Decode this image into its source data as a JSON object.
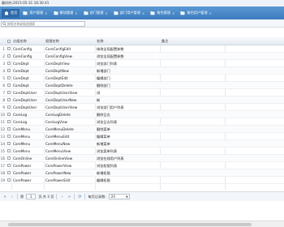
{
  "topbar": {
    "text": "最好的:2015-05-31 18:30:41"
  },
  "tabs": [
    {
      "label": "首页",
      "icon": "home-icon"
    },
    {
      "label": "用户管理",
      "icon": "folder-icon"
    },
    {
      "label": "模块管理",
      "icon": "folder-icon"
    },
    {
      "label": "部门管理",
      "icon": "folder-icon"
    },
    {
      "label": "部门用户管理",
      "icon": "folder-icon"
    },
    {
      "label": "角色管理",
      "icon": "folder-icon"
    },
    {
      "label": "角色用户管理",
      "icon": "folder-icon"
    }
  ],
  "search": {
    "placeholder": "按照名称或描述搜索"
  },
  "table": {
    "headers": [
      "",
      "",
      "分组名称",
      "权限名称",
      "名称",
      "备注"
    ],
    "rows": [
      [
        "1",
        "CoreConfig",
        "CoreConfigEdit",
        "修改全局配置参数",
        ""
      ],
      [
        "2",
        "CoreConfig",
        "CoreConfigView",
        "浏览全局配置参数",
        ""
      ],
      [
        "3",
        "CoreDept",
        "CoreDeptView",
        "浏览部门列表",
        ""
      ],
      [
        "4",
        "CoreDept",
        "CoreDeptNew",
        "新增部门",
        ""
      ],
      [
        "5",
        "CoreDept",
        "CoreDeptEdit",
        "编辑部门",
        ""
      ],
      [
        "6",
        "CoreDept",
        "CoreDeptDelete",
        "删除部门",
        ""
      ],
      [
        "7",
        "CoreDeptUser",
        "CoreDeptUserView",
        "浏",
        ""
      ],
      [
        "8",
        "CoreDeptUser",
        "CoreDeptUserNew",
        "新",
        ""
      ],
      [
        "9",
        "CoreDeptUser",
        "CoreDeptUserView",
        "浏览部门用户列表",
        ""
      ],
      [
        "10",
        "CoreLog",
        "CoreLogDelete",
        "删除日志",
        ""
      ],
      [
        "11",
        "CoreLog",
        "CoreLogView",
        "浏览日志列表",
        ""
      ],
      [
        "12",
        "CoreMenu",
        "CoreMenuDelete",
        "删除菜单",
        ""
      ],
      [
        "13",
        "CoreMenu",
        "CoreMenuEdit",
        "编辑菜单",
        ""
      ],
      [
        "14",
        "CoreMenu",
        "CoreMenuNew",
        "新增菜单",
        ""
      ],
      [
        "15",
        "CoreMenu",
        "CoreMenuView",
        "浏览菜单列表",
        ""
      ],
      [
        "16",
        "CoreOnline",
        "CoreOnlineView",
        "浏览在线用户列表",
        ""
      ],
      [
        "17",
        "CorePower",
        "CorePowerView",
        "浏览权限列表",
        ""
      ],
      [
        "18",
        "CorePower",
        "CorePowerNew",
        "新增权限",
        ""
      ],
      [
        "19",
        "CorePower",
        "CorePowerEdit",
        "编辑权限",
        ""
      ]
    ]
  },
  "pager": {
    "prefix": "第",
    "page": "1",
    "suffix": "页,共 3 页",
    "per_page_label": "每页记录数:",
    "per_page": "20"
  },
  "colors": {
    "tab_bar": "#4a8ac8",
    "header_bg": "#e6ebf1"
  }
}
